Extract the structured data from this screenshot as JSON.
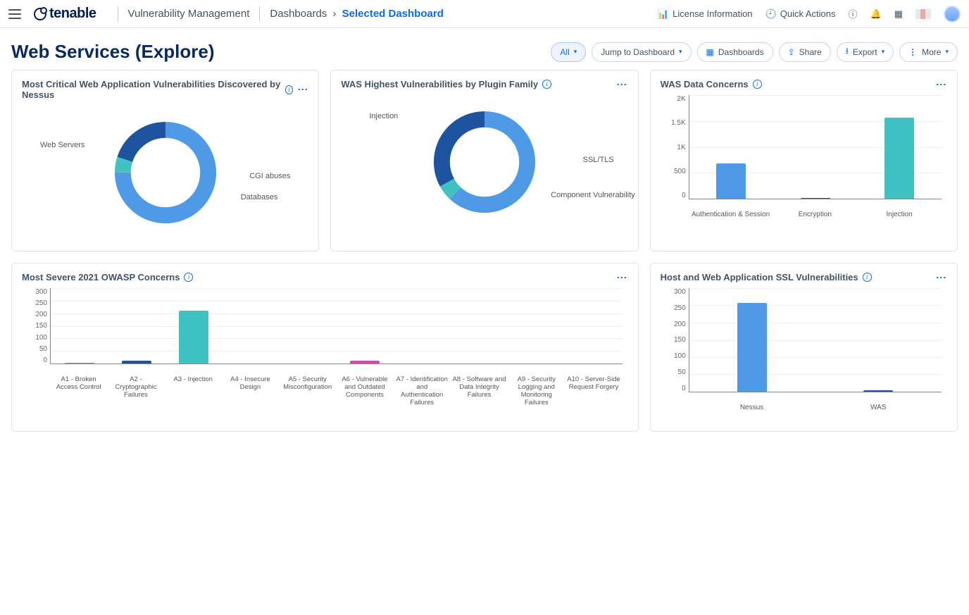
{
  "header": {
    "app": "Vulnerability Management",
    "logo_text": "tenable",
    "bc_root": "Dashboards",
    "bc_current": "Selected Dashboard",
    "license": "License Information",
    "quick": "Quick Actions"
  },
  "page": {
    "title": "Web Services (Explore)"
  },
  "actions": {
    "all": "All",
    "jump": "Jump to Dashboard",
    "dashboards": "Dashboards",
    "share": "Share",
    "export": "Export",
    "more": "More"
  },
  "cards": {
    "c1": {
      "title": "Most Critical Web Application Vulnerabilities Discovered by Nessus"
    },
    "c2": {
      "title": "WAS Highest Vulnerabilities by Plugin Family"
    },
    "c3": {
      "title": "WAS Data Concerns"
    },
    "c4": {
      "title": "Most Severe 2021 OWASP Concerns"
    },
    "c5": {
      "title": "Host and Web Application SSL Vulnerabilities"
    }
  },
  "chart_data": [
    {
      "id": "c1",
      "type": "pie",
      "title": "Most Critical Web Application Vulnerabilities Discovered by Nessus",
      "series": [
        {
          "name": "Web Servers",
          "value": 75,
          "color": "#4f9ae6"
        },
        {
          "name": "CGI abuses",
          "value": 5,
          "color": "#41c2c2"
        },
        {
          "name": "Databases",
          "value": 20,
          "color": "#1e53a0"
        }
      ]
    },
    {
      "id": "c2",
      "type": "pie",
      "title": "WAS Highest Vulnerabilities by Plugin Family",
      "series": [
        {
          "name": "Injection",
          "value": 62,
          "color": "#4f9ae6"
        },
        {
          "name": "SSL/TLS",
          "value": 5,
          "color": "#41c2c2"
        },
        {
          "name": "Component Vulnerability",
          "value": 33,
          "color": "#1e53a0"
        }
      ]
    },
    {
      "id": "c3",
      "type": "bar",
      "title": "WAS Data Concerns",
      "ylim": [
        0,
        2000
      ],
      "ticks": [
        "2K",
        "1.5K",
        "1K",
        "500",
        "0"
      ],
      "categories": [
        "Authentication & Session",
        "Encryption",
        "Injection"
      ],
      "series": [
        {
          "name": "Authentication & Session",
          "value": 680,
          "color": "#4f9ae6"
        },
        {
          "name": "Encryption",
          "value": 20,
          "color": "#1e53a0"
        },
        {
          "name": "Injection",
          "value": 1570,
          "color": "#41c2c2"
        }
      ]
    },
    {
      "id": "c4",
      "type": "bar",
      "title": "Most Severe 2021 OWASP Concerns",
      "ylim": [
        0,
        300
      ],
      "ticks": [
        "300",
        "250",
        "200",
        "150",
        "100",
        "50",
        "0"
      ],
      "categories": [
        "A1 - Broken Access Control",
        "A2 - Cryptographic Failures",
        "A3 - Injection",
        "A4 - Insecure Design",
        "A5 - Security Misconfiguration",
        "A6 - Vulnerable and Outdated Components",
        "A7 - Identification and Authentication Failures",
        "A8 - Software and Data Integrity Failures",
        "A9 - Security Logging and Monitoring Failures",
        "A10 - Server-Side Request Forgery"
      ],
      "series": [
        {
          "name": "A1",
          "value": 2,
          "color": "#4f9ae6"
        },
        {
          "name": "A2",
          "value": 12,
          "color": "#1e53a0"
        },
        {
          "name": "A3",
          "value": 210,
          "color": "#41c2c2"
        },
        {
          "name": "A4",
          "value": 0,
          "color": "#4f9ae6"
        },
        {
          "name": "A5",
          "value": 0,
          "color": "#4f9ae6"
        },
        {
          "name": "A6",
          "value": 10,
          "color": "#d946b5"
        },
        {
          "name": "A7",
          "value": 0,
          "color": "#4f9ae6"
        },
        {
          "name": "A8",
          "value": 0,
          "color": "#4f9ae6"
        },
        {
          "name": "A9",
          "value": 0,
          "color": "#4f9ae6"
        },
        {
          "name": "A10",
          "value": 0,
          "color": "#4f9ae6"
        }
      ]
    },
    {
      "id": "c5",
      "type": "bar",
      "title": "Host and Web Application SSL Vulnerabilities",
      "ylim": [
        0,
        300
      ],
      "ticks": [
        "300",
        "250",
        "200",
        "150",
        "100",
        "50",
        "0"
      ],
      "categories": [
        "Nessus",
        "WAS"
      ],
      "series": [
        {
          "name": "Nessus",
          "value": 258,
          "color": "#4f9ae6"
        },
        {
          "name": "WAS",
          "value": 4,
          "color": "#1e53a0"
        }
      ]
    }
  ]
}
